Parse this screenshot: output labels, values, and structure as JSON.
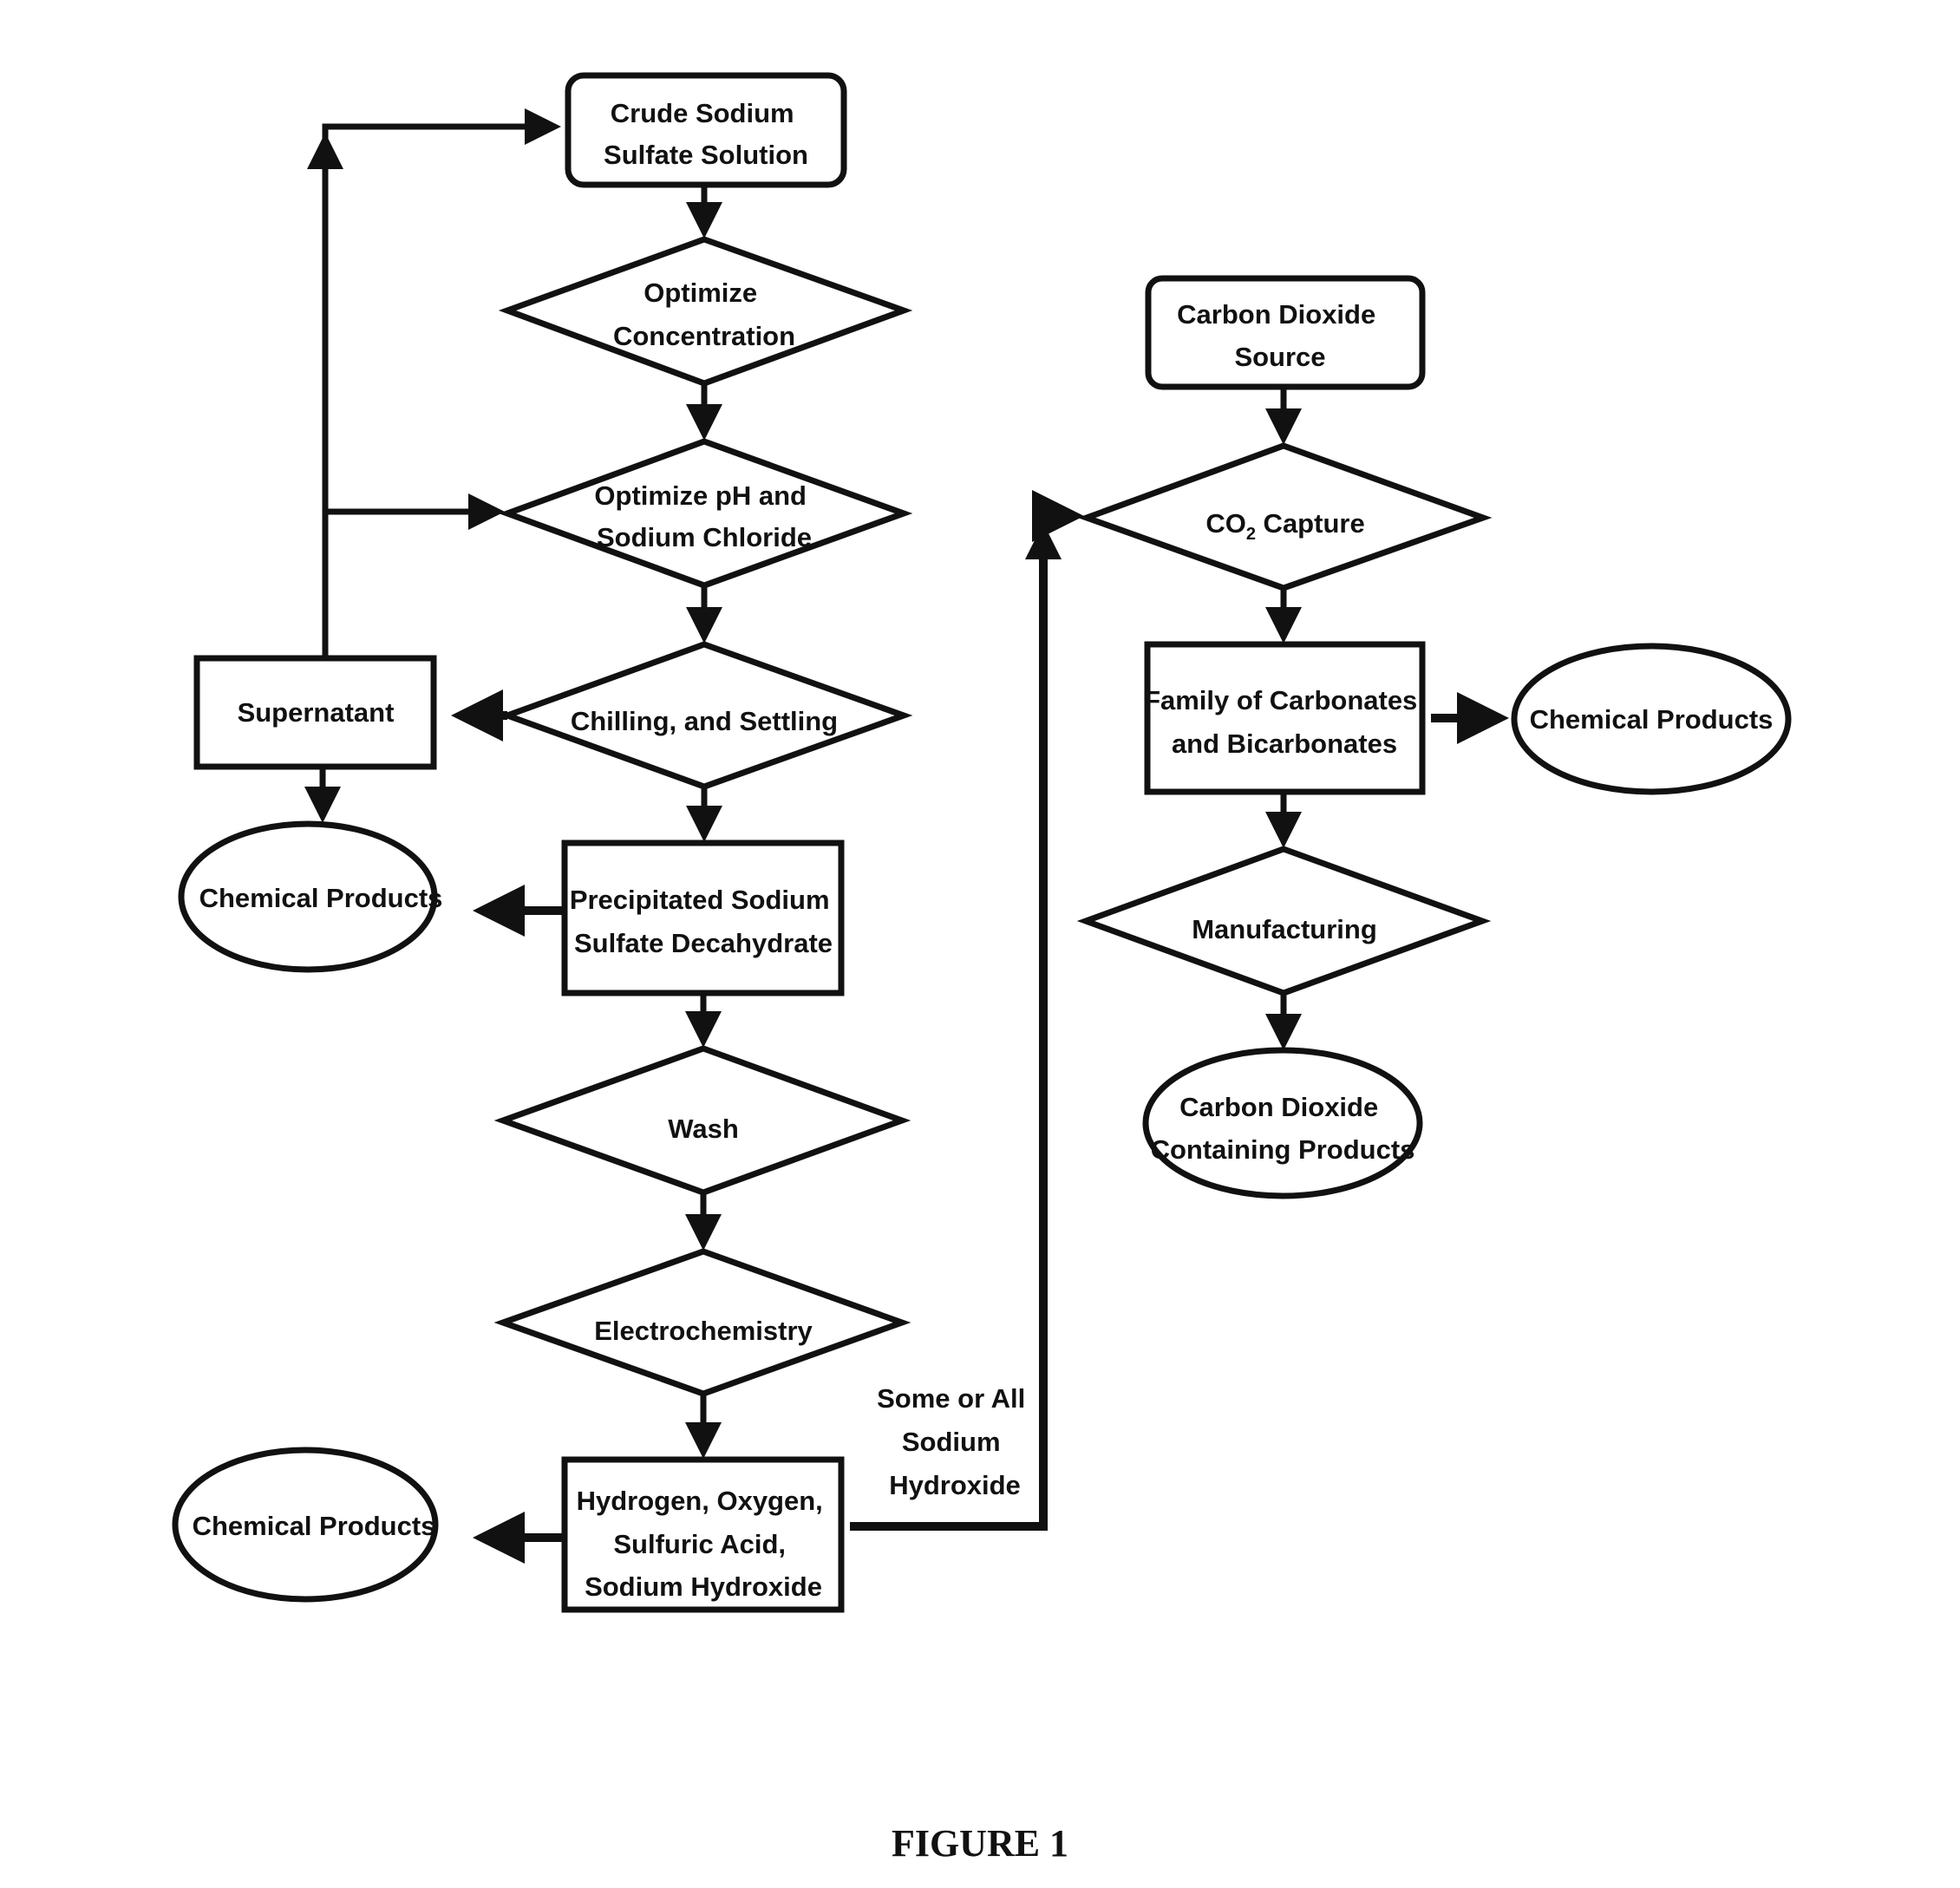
{
  "figure": {
    "caption": "FIGURE 1",
    "nodes": {
      "crude": [
        "Crude Sodium",
        "Sulfate Solution"
      ],
      "opt_conc": [
        "Optimize",
        "Concentration"
      ],
      "opt_ph": [
        "Optimize pH and",
        "Sodium Chloride"
      ],
      "chill": [
        "Chilling, and Settling"
      ],
      "supernatant": [
        "Supernatant"
      ],
      "chem1": [
        "Chemical Products"
      ],
      "precip": [
        "Precipitated Sodium",
        "Sulfate Decahydrate"
      ],
      "wash": [
        "Wash"
      ],
      "electro": [
        "Electrochemistry"
      ],
      "hydrogen": [
        "Hydrogen, Oxygen,",
        "Sulfuric Acid,",
        "Sodium Hydroxide"
      ],
      "chem3": [
        "Chemical Products"
      ],
      "co2_source": [
        "Carbon Dioxide",
        "Source"
      ],
      "co2_capture_prefix": "CO",
      "co2_capture_sub": "2",
      "co2_capture_suffix": " Capture",
      "family": [
        "Family of Carbonates",
        "and Bicarbonates"
      ],
      "chem_right": [
        "Chemical Products"
      ],
      "manufacturing": [
        "Manufacturing"
      ],
      "co2_products": [
        "Carbon Dioxide",
        "Containing Products"
      ]
    },
    "edge_label_naoh": [
      "Some or All",
      "Sodium",
      "Hydroxide"
    ]
  }
}
